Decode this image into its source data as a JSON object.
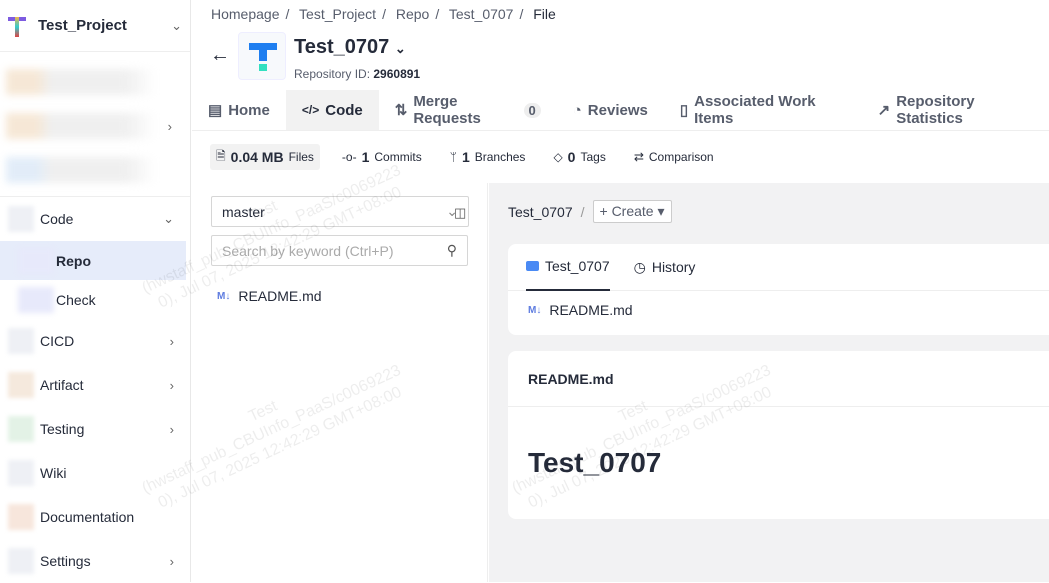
{
  "sidebar": {
    "project": "Test_Project",
    "items": [
      {
        "label": "Code",
        "sub": [
          {
            "label": "Repo"
          },
          {
            "label": "Check"
          }
        ]
      },
      {
        "label": "CICD"
      },
      {
        "label": "Artifact"
      },
      {
        "label": "Testing"
      },
      {
        "label": "Wiki"
      },
      {
        "label": "Documentation"
      },
      {
        "label": "Settings"
      }
    ]
  },
  "breadcrumb": [
    "Homepage",
    "Test_Project",
    "Repo",
    "Test_0707",
    "File"
  ],
  "repo": {
    "name": "Test_0707",
    "id_label": "Repository ID:",
    "id": "2960891"
  },
  "tabs": [
    {
      "label": "Home",
      "icon": "home-icon"
    },
    {
      "label": "Code",
      "icon": "code-icon"
    },
    {
      "label": "Merge Requests",
      "count": "0",
      "icon": "merge-icon"
    },
    {
      "label": "Reviews",
      "icon": "review-icon"
    },
    {
      "label": "Associated Work Items",
      "icon": "doc-icon"
    },
    {
      "label": "Repository Statistics",
      "icon": "chart-icon"
    }
  ],
  "stats": {
    "files_value": "0.04 MB",
    "files_label": "Files",
    "commits_value": "1",
    "commits_label": "Commits",
    "branches_value": "1",
    "branches_label": "Branches",
    "tags_value": "0",
    "tags_label": "Tags",
    "comparison": "Comparison"
  },
  "filetree": {
    "branch": "master",
    "search_placeholder": "Search by keyword (Ctrl+P)",
    "files": [
      "README.md"
    ]
  },
  "content": {
    "path": "Test_0707",
    "create": "+ Create",
    "tab_files": "Test_0707",
    "tab_history": "History",
    "files": [
      "README.md"
    ],
    "readme_title": "README.md",
    "readme_h1": "Test_0707"
  },
  "watermark": {
    "line1": "Test",
    "line2": "(hwstaff_pub_CBUInfo_PaaS/c0069223",
    "line3": "0), Jul 07, 2025 12:42:29 GMT+08:00"
  },
  "colors": {
    "accent": "#5e7ce0",
    "folder": "#4a8af4",
    "active_sidebar": "#e6ecfa"
  }
}
